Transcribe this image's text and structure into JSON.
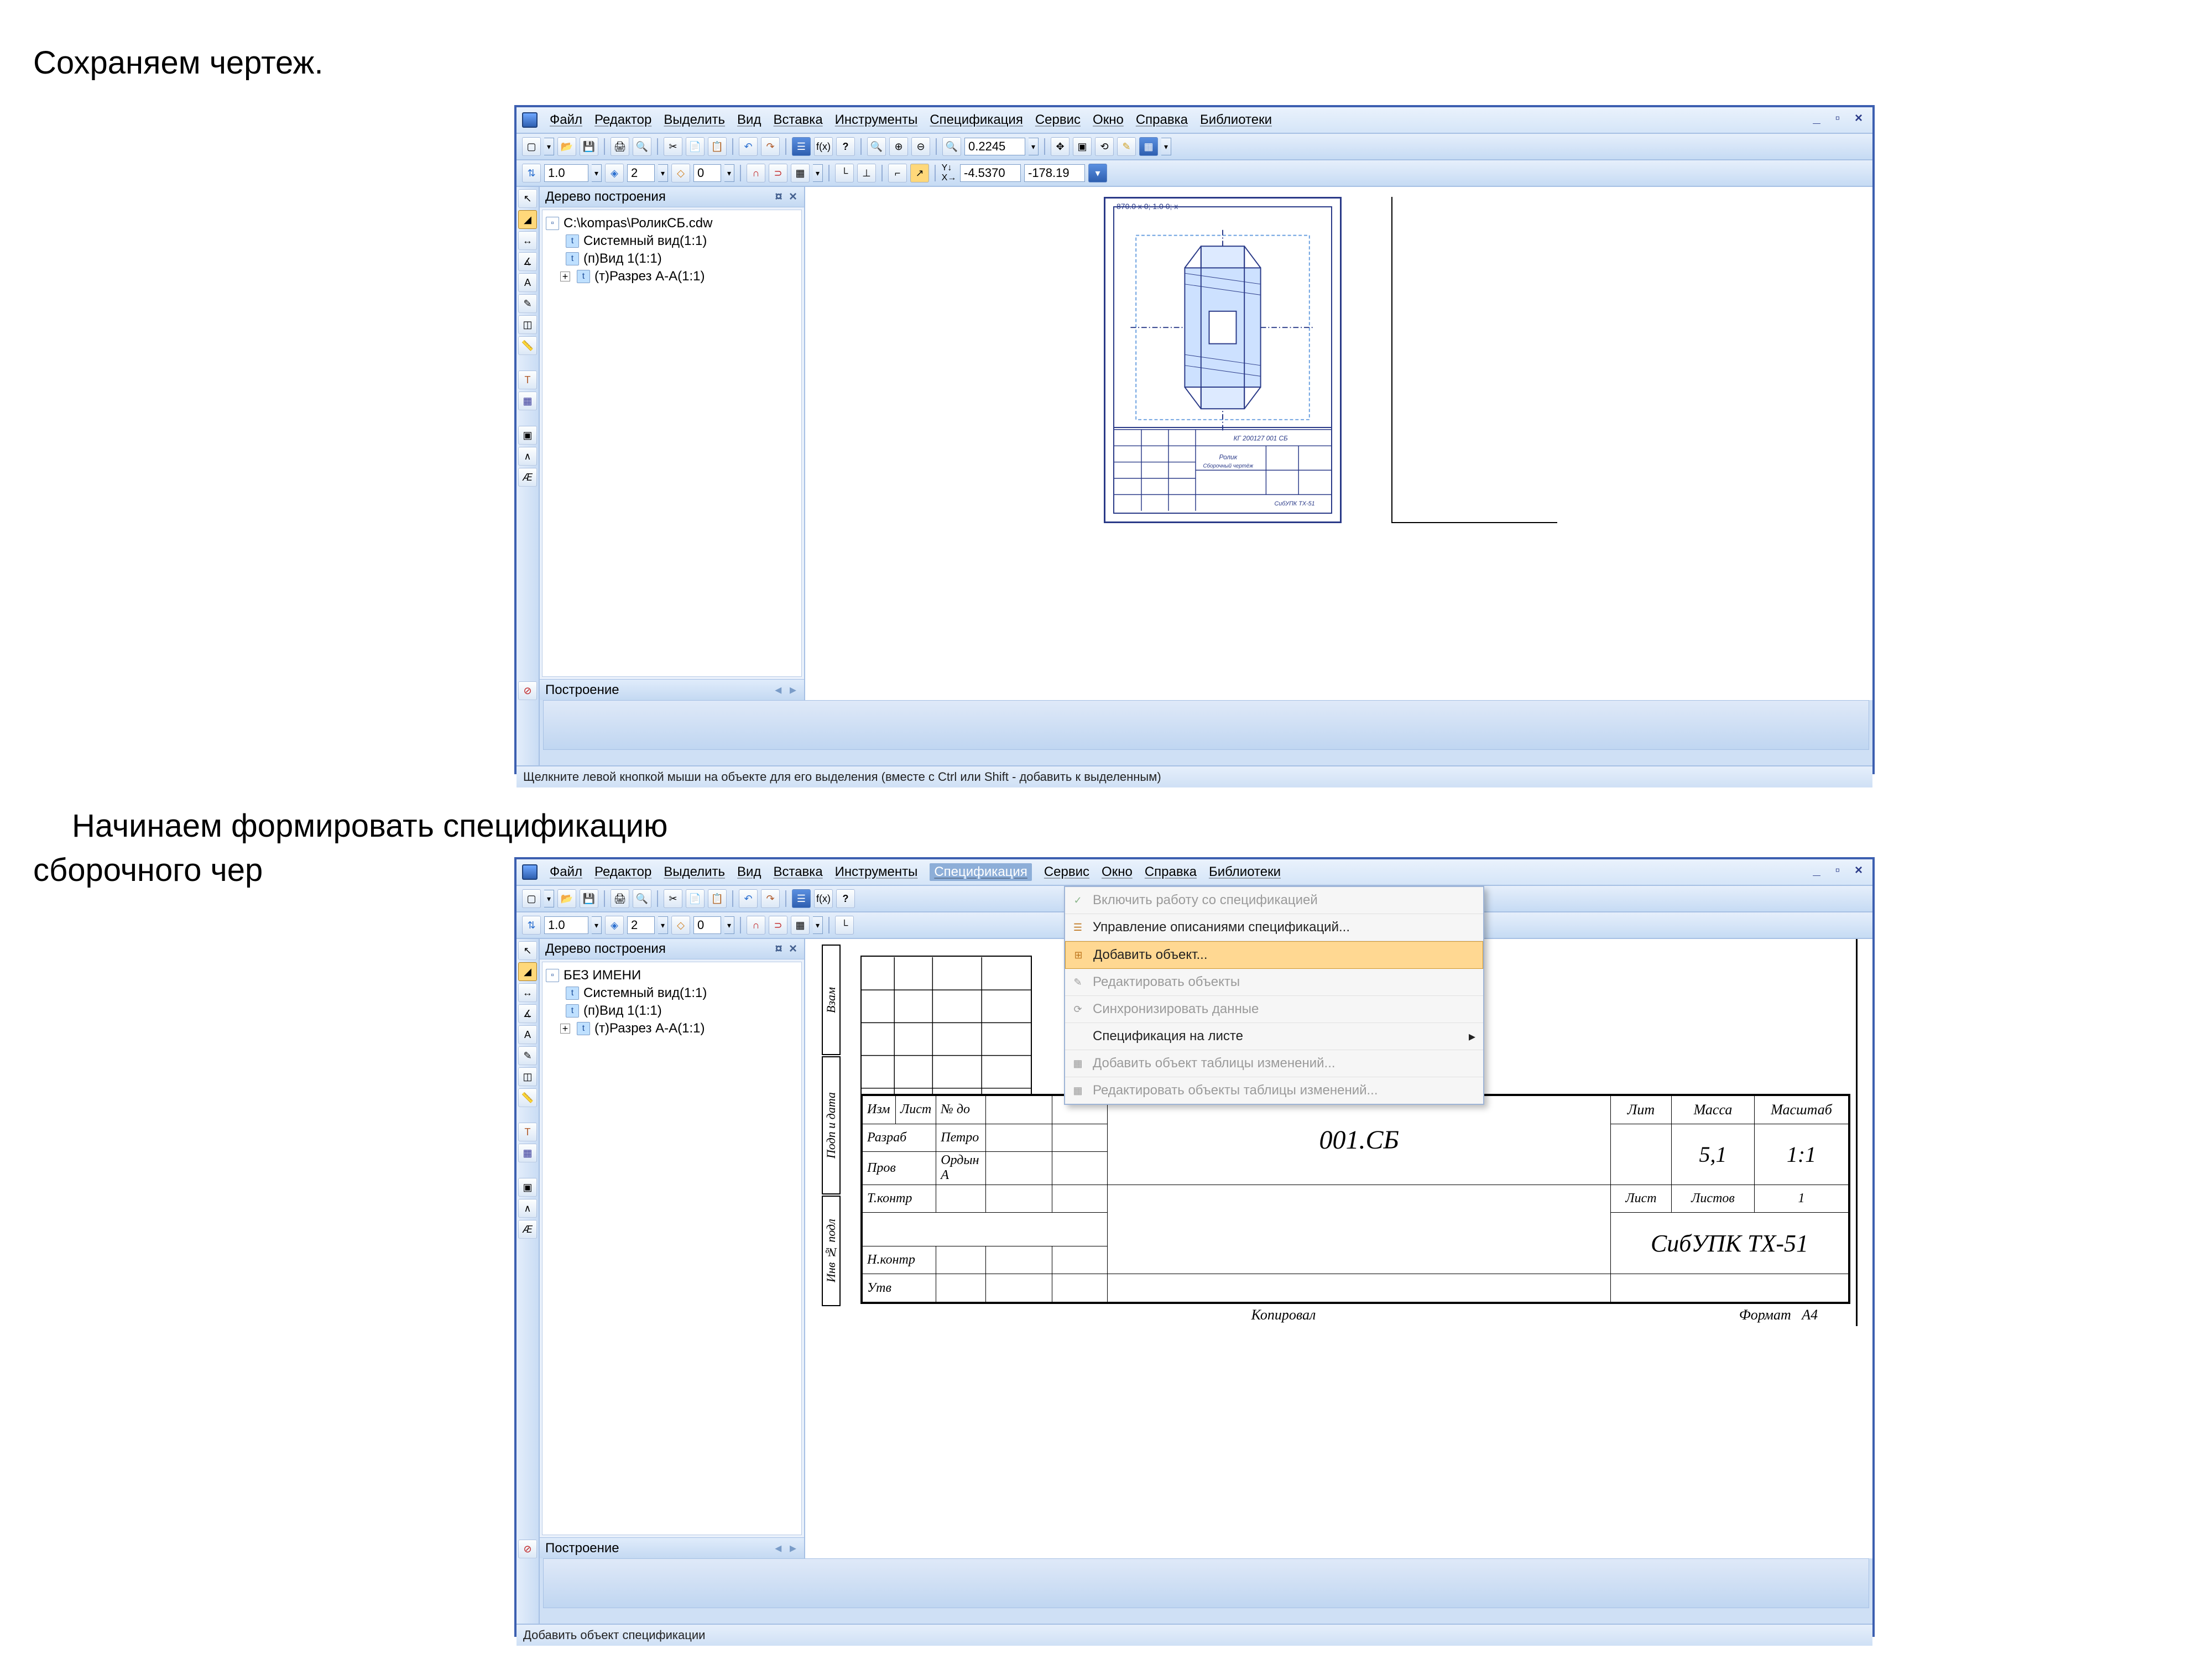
{
  "doc": {
    "text1": "Сохраняем чертеж.",
    "text2": "Начинаем формировать спецификацию",
    "text3": "сборочного чер"
  },
  "menu": {
    "file": "Файл",
    "editor": "Редактор",
    "select": "Выделить",
    "view": "Вид",
    "insert": "Вставка",
    "tools": "Инструменты",
    "spec": "Спецификация",
    "service": "Сервис",
    "window": "Окно",
    "help": "Справка",
    "libs": "Библиотеки"
  },
  "toolbar2": {
    "scale": "1.0",
    "layer": "2",
    "zero": "0"
  },
  "zoom_field": "0.2245",
  "coords": {
    "x": "-4.5370",
    "y": "-178.19"
  },
  "tree": {
    "title": "Дерево построения",
    "root1": "C:\\kompas\\РоликСБ.cdw",
    "root2": "БЕЗ ИМЕНИ",
    "items": [
      "Системный вид(1:1)",
      "(п)Вид 1(1:1)",
      "(т)Разрез А-А(1:1)"
    ],
    "footer": "Построение"
  },
  "status1": "Щелкните левой кнопкой мыши на объекте для его выделения (вместе с Ctrl или Shift - добавить к выделенным)",
  "status2": "Добавить объект спецификации",
  "spec_menu": {
    "items": [
      "Включить работу со спецификацией",
      "Управление описаниями спецификаций...",
      "Добавить объект...",
      "Редактировать объекты",
      "Синхронизировать данные",
      "Спецификация на листе",
      "Добавить объект таблицы изменений...",
      "Редактировать объекты таблицы изменений..."
    ]
  },
  "titleblock": {
    "code": "001.СБ",
    "lit": "Лит",
    "mass": "Масса",
    "scale_h": "Масштаб",
    "mass_v": "5,1",
    "scale_v": "1:1",
    "list": "Лист",
    "listov": "Листов",
    "listov_n": "1",
    "org": "СибУПК ТХ-51",
    "copied": "Копировал",
    "format": "Формат",
    "format_v": "А4",
    "izm": "Изм",
    "list2": "Лист",
    "ndoc": "№ до",
    "razrab": "Разраб",
    "prov": "Пров",
    "tkontr": "Т.контр",
    "nkontr": "Н.контр",
    "utv": "Утв",
    "name1": "Петро",
    "name2": "Ордын А",
    "vlabel1": "Взам",
    "vlabel2": "Подп и дата",
    "vlabel3": "Инв № подл"
  },
  "drawing_top": "870.0 x 0; 1.0 0; x"
}
